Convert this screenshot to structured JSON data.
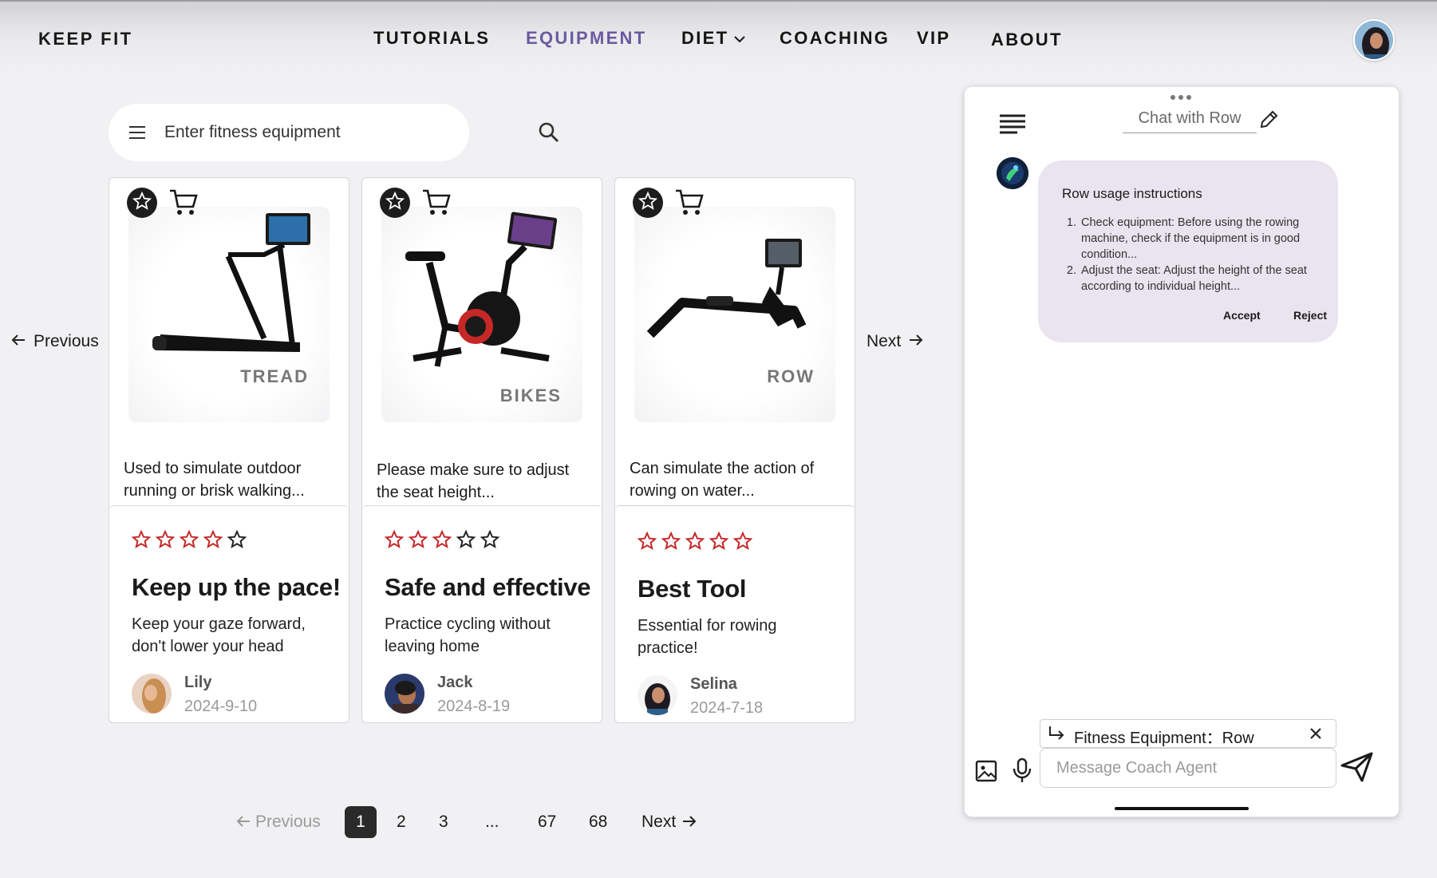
{
  "header": {
    "brand": "KEEP FIT",
    "nav": [
      {
        "label": "TUTORIALS"
      },
      {
        "label": "EQUIPMENT"
      },
      {
        "label": "DIET"
      },
      {
        "label": "COACHING"
      },
      {
        "label": "VIP"
      },
      {
        "label": "ABOUT"
      }
    ],
    "active_nav": "EQUIPMENT",
    "accent_color": "#6a5a9e"
  },
  "search": {
    "placeholder": "Enter fitness equipment",
    "value": ""
  },
  "carousel": {
    "prev_label": "Previous",
    "next_label": "Next"
  },
  "cards": [
    {
      "image_label": "TREAD",
      "description": "Used to simulate outdoor running or brisk walking...",
      "rating": 4,
      "title": "Keep up the pace!",
      "subtitle": "Keep your gaze forward, don't lower your head",
      "author": "Lily",
      "date": "2024-9-10"
    },
    {
      "image_label": "BIKES",
      "description": "Please make sure to adjust the seat height...",
      "rating": 3,
      "title": "Safe and effective",
      "subtitle": "Practice cycling without leaving home",
      "author": "Jack",
      "date": "2024-8-19"
    },
    {
      "image_label": "ROW",
      "description": "Can simulate the action of rowing on water...",
      "rating": 5,
      "title": "Best Tool",
      "subtitle": "Essential for rowing practice!",
      "author": "Selina",
      "date": "2024-7-18"
    }
  ],
  "star_color": "#c62828",
  "pagination": {
    "prev_label": "Previous",
    "pages": [
      "1",
      "2",
      "3",
      "...",
      "67",
      "68"
    ],
    "current": "1",
    "next_label": "Next"
  },
  "chat": {
    "title": "Chat with Row",
    "message": {
      "title": "Row usage instructions",
      "items": [
        "Check equipment: Before using the rowing machine, check if the equipment is in good condition...",
        "Adjust the seat: Adjust the height of the seat according to individual height..."
      ],
      "accept_label": "Accept",
      "reject_label": "Reject"
    },
    "bubble_color": "#e9e4ef",
    "context_chip": "Fitness Equipment：Row",
    "input_placeholder": "Message Coach Agent",
    "input_value": ""
  }
}
